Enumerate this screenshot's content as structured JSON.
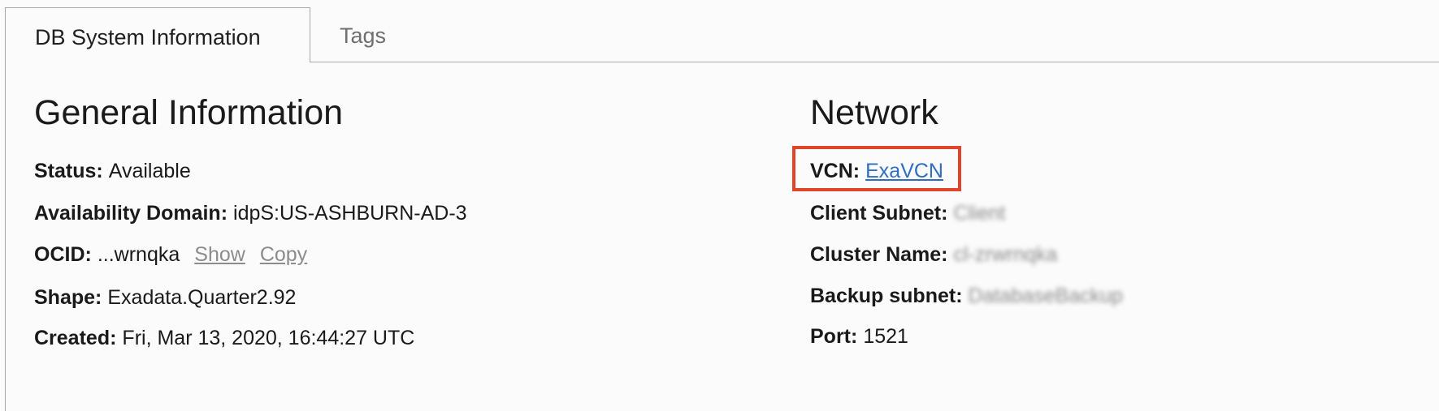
{
  "tabs": {
    "active": "DB System Information",
    "inactive": "Tags"
  },
  "general": {
    "title": "General Information",
    "status_label": "Status:",
    "status_value": "Available",
    "ad_label": "Availability Domain:",
    "ad_value": "idpS:US-ASHBURN-AD-3",
    "ocid_label": "OCID:",
    "ocid_value": "...wrnqka",
    "ocid_show": "Show",
    "ocid_copy": "Copy",
    "shape_label": "Shape:",
    "shape_value": "Exadata.Quarter2.92",
    "created_label": "Created:",
    "created_value": "Fri, Mar 13, 2020, 16:44:27 UTC"
  },
  "network": {
    "title": "Network",
    "vcn_label": "VCN:",
    "vcn_value": "ExaVCN",
    "client_subnet_label": "Client Subnet:",
    "client_subnet_value": "Client",
    "cluster_name_label": "Cluster Name:",
    "cluster_name_value": "cl-zrwrnqka",
    "backup_subnet_label": "Backup subnet:",
    "backup_subnet_value": "DatabaseBackup",
    "port_label": "Port:",
    "port_value": "1521"
  },
  "colors": {
    "link": "#2e6ec2",
    "highlight": "#e0442a"
  }
}
